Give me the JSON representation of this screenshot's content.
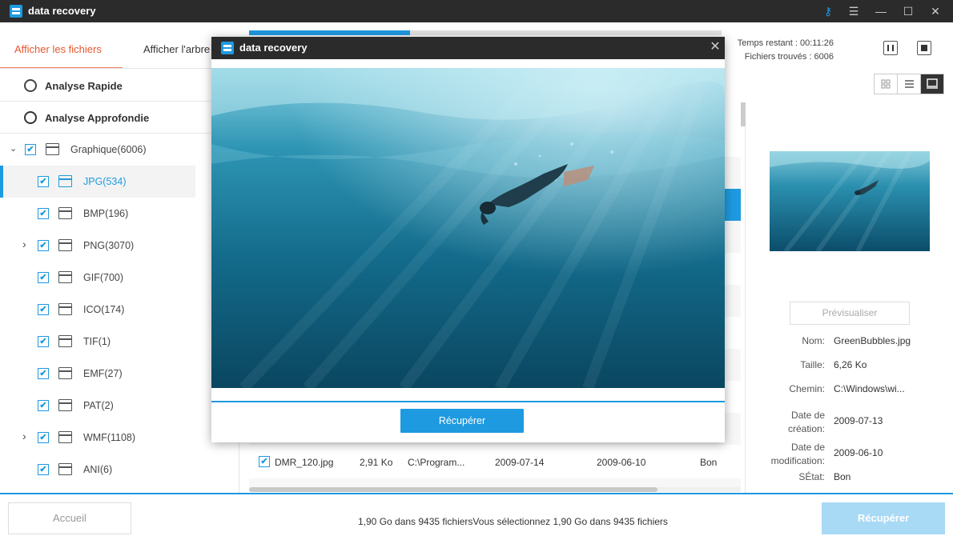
{
  "window": {
    "title": "data recovery"
  },
  "tabs": {
    "files": "Afficher les fichiers",
    "tree": "Afficher l'arbre"
  },
  "scan": {
    "quick": "Analyse Rapide",
    "deep": "Analyse Approfondie"
  },
  "tree": {
    "root": "Graphique(6006)",
    "items": [
      {
        "label": "JPG(534)"
      },
      {
        "label": "BMP(196)"
      },
      {
        "label": "PNG(3070)"
      },
      {
        "label": "GIF(700)"
      },
      {
        "label": "ICO(174)"
      },
      {
        "label": "TIF(1)"
      },
      {
        "label": "EMF(27)"
      },
      {
        "label": "PAT(2)"
      },
      {
        "label": "WMF(1108)"
      },
      {
        "label": "ANI(6)"
      }
    ]
  },
  "status": {
    "time_remaining": "Temps restant : 00:11:26",
    "files_found": "Fichiers trouvés : 6006",
    "progress_fraction": 0.34
  },
  "file_row": {
    "checked": "✔",
    "name": "DMR_120.jpg",
    "size": "2,91 Ko",
    "path": "C:\\Program...",
    "created": "2009-07-14",
    "modified": "2009-06-10",
    "state": "Bon"
  },
  "details": {
    "preview_label": "Prévisualiser",
    "name_key": "Nom:",
    "name_val": "GreenBubbles.jpg",
    "size_key": "Taille:",
    "size_val": "6,26 Ko",
    "path_key": "Chemin:",
    "path_val": "C:\\Windows\\wi...",
    "created_key": "Date de création:",
    "created_val": "2009-07-13",
    "modified_key": "Date de modification:",
    "modified_val": "2009-06-10",
    "state_key": "SÉtat:",
    "state_val": "Bon"
  },
  "bottom": {
    "home": "Accueil",
    "summary": "1,90 Go dans 9435 fichiersVous sélectionnez 1,90 Go dans 9435 fichiers",
    "recover": "Récupérer"
  },
  "modal": {
    "title": "data recovery",
    "recover": "Récupérer"
  },
  "icons": {
    "key": "key-icon",
    "menu": "menu-icon",
    "minimize": "minimize-icon",
    "maximize": "maximize-icon",
    "close": "close-icon",
    "check_mark": "✔",
    "chev_down": "⌄",
    "chev_right": "›",
    "key_glyph": "⚷",
    "menu_glyph": "☰",
    "min_glyph": "—",
    "max_glyph": "☐",
    "close_glyph": "✕"
  },
  "colors": {
    "accent": "#1e9ae0",
    "tab_active": "#e8562e",
    "titlebar": "#2b2b2b"
  }
}
